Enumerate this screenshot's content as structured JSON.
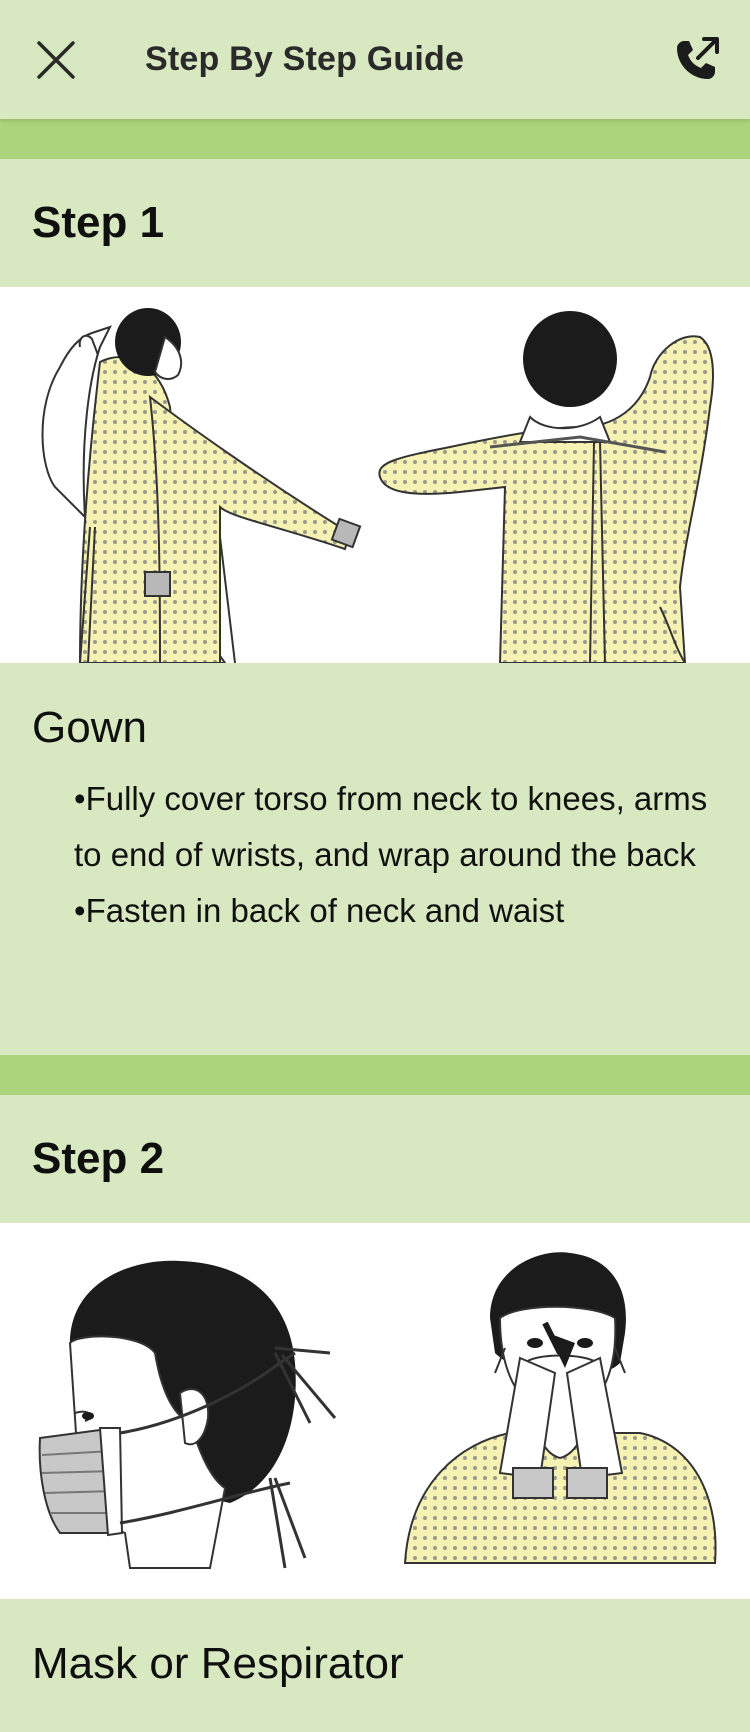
{
  "header": {
    "title": "Step By Step Guide",
    "close_icon": "close-icon",
    "call_icon": "outgoing-call-icon"
  },
  "colors": {
    "background": "#d8e8c0",
    "divider": "#acd47c",
    "gown_fill": "#f6f2b4",
    "mask_fill": "#c8c8c8"
  },
  "steps": [
    {
      "label": "Step 1",
      "title": "Gown",
      "bullets": [
        "Fully cover torso from neck to knees, arms to end of wrists, and wrap around the back",
        "Fasten in back of neck and waist"
      ]
    },
    {
      "label": "Step 2",
      "title": "Mask or Respirator",
      "bullets": []
    }
  ]
}
